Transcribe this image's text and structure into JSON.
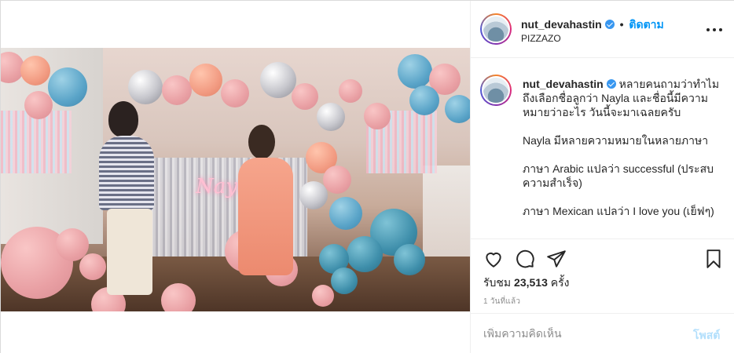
{
  "post": {
    "username": "nut_devahastin",
    "verified": true,
    "separator": "•",
    "follow_label": "ติดตาม",
    "location": "PIZZAZO",
    "more_icon": "more-options-icon"
  },
  "media": {
    "neon_sign": "Nayla",
    "user_tag_icon": "user-tag-icon",
    "sound_icon": "sound-icon"
  },
  "caption": {
    "username": "nut_devahastin",
    "lines": [
      "หลายคนถามว่าทำไมถึงเลือกชื่อลูกว่า Nayla และชื่อนี้มีความหมายว่าอะไร วันนี้จะมาเฉลยครับ",
      "Nayla มีหลายความหมายในหลายภาษา",
      "ภาษา Arabic แปลว่า successful (ประสบความสำเร็จ)",
      "ภาษา Mexican แปลว่า I love you (เย็ฟๆ)"
    ]
  },
  "actions": {
    "like_icon": "heart-icon",
    "comment_icon": "comment-icon",
    "share_icon": "share-icon",
    "save_icon": "bookmark-icon",
    "views_prefix": "รับชม",
    "views_count": "23,513",
    "views_suffix": "ครั้ง",
    "time_ago": "1 วันที่แล้ว"
  },
  "comment": {
    "placeholder": "เพิ่มความคิดเห็น",
    "post_label": "โพสต์"
  },
  "colors": {
    "accent": "#0095f6",
    "post_disabled": "#b2dffc",
    "text": "#262626",
    "muted": "#8e8e8e"
  }
}
